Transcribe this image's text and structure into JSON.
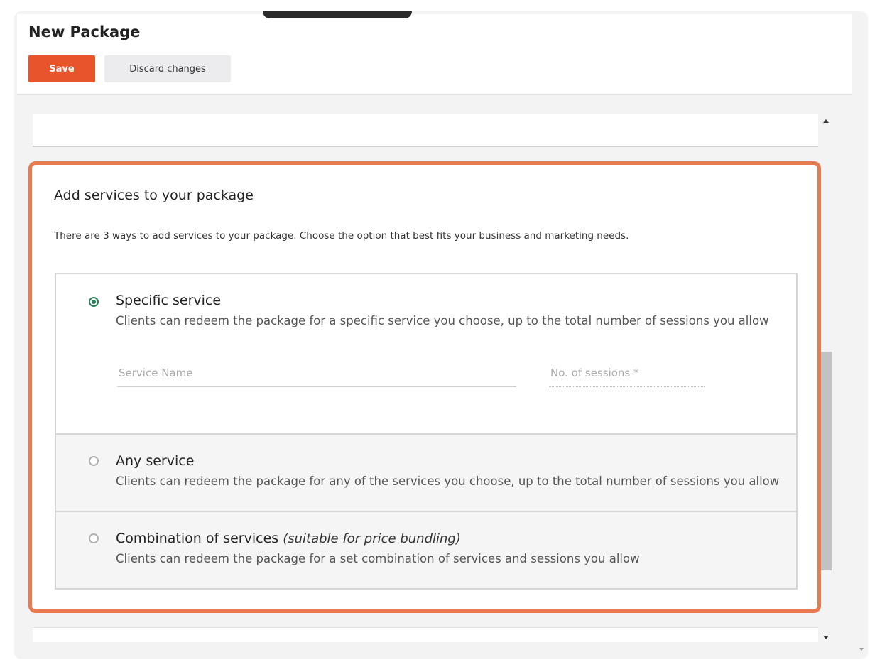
{
  "header": {
    "title": "New Package",
    "save_label": "Save",
    "discard_label": "Discard changes"
  },
  "section": {
    "title": "Add services to your package",
    "description": "There are 3 ways to add services to your package. Choose the option that best fits your business and marketing needs."
  },
  "options": [
    {
      "title": "Specific service",
      "description": "Clients can redeem the package for a specific service you choose, up to the total number of sessions you allow",
      "selected": true
    },
    {
      "title": "Any service",
      "description": "Clients can redeem the package for any of the services you choose, up to the total number of sessions you allow",
      "selected": false
    },
    {
      "title": "Combination of services",
      "title_note": "(suitable for price bundling)",
      "description": "Clients can redeem the package for a set combination of services and sessions you allow",
      "selected": false
    }
  ],
  "fields": {
    "service_name_placeholder": "Service Name",
    "sessions_placeholder": "No. of sessions *"
  },
  "colors": {
    "accent": "#e8552c",
    "highlight_border": "#e87a4f",
    "radio_selected": "#2e7d5b"
  }
}
